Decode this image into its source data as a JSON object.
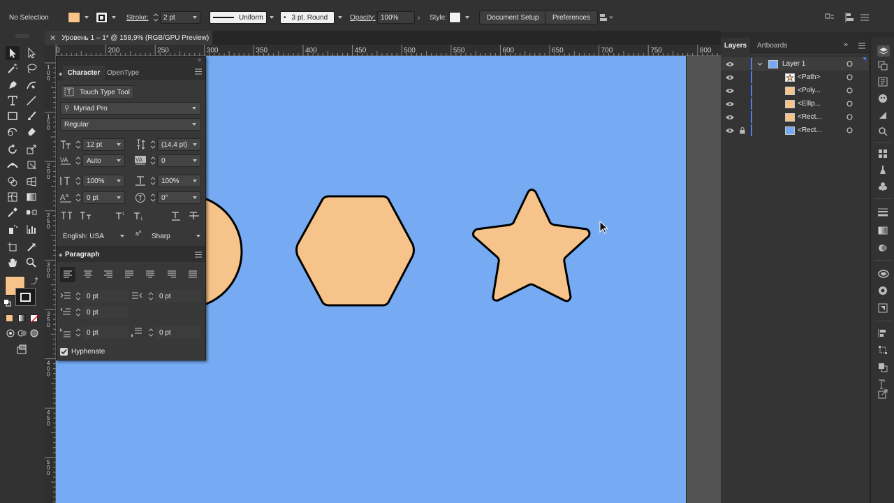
{
  "control_bar": {
    "selection_label": "No Selection",
    "fill_color": "#f6c38a",
    "stroke_label": "Stroke:",
    "stroke_weight": "2 pt",
    "profile": "Uniform",
    "brush": "3 pt. Round",
    "opacity_label": "Opacity:",
    "opacity_value": "100%",
    "style_label": "Style:",
    "document_setup": "Document Setup",
    "preferences": "Preferences"
  },
  "document_tab": {
    "title": "Уровень 1 – 1* @ 158,9% (RGB/GPU Preview)"
  },
  "ruler": {
    "h_ticks": [
      "200",
      "250",
      "300",
      "350",
      "400",
      "450",
      "500",
      "550",
      "600",
      "650",
      "700",
      "750",
      "800"
    ],
    "v_ticks": [
      "1\n0\n0",
      "1\n5\n0",
      "2\n0\n0",
      "2\n5\n0",
      "3\n0\n0",
      "3\n5\n0",
      "4\n0\n0",
      "4\n5\n0",
      "5\n0\n0"
    ]
  },
  "colors": {
    "artboard": "#76abf4",
    "shape_fill": "#f6c38a",
    "shape_stroke": "#000000",
    "panel_bg": "#383838"
  },
  "character_panel": {
    "tab_character": "Character",
    "tab_opentype": "OpenType",
    "touch_type": "Touch Type Tool",
    "font_family": "Myriad Pro",
    "font_style": "Regular",
    "font_size": "12 pt",
    "leading": "(14,4 pt)",
    "kerning": "Auto",
    "tracking": "0",
    "vertical_scale": "100%",
    "horizontal_scale": "100%",
    "baseline_shift": "0 pt",
    "rotation": "0°",
    "language": "English: USA",
    "antialias_icon": "a",
    "antialias": "Sharp"
  },
  "paragraph_panel": {
    "title": "Paragraph",
    "left_indent": "0 pt",
    "right_indent": "0 pt",
    "first_line_indent": "0 pt",
    "space_before": "0 pt",
    "space_after": "0 pt",
    "hyphenate": "Hyphenate"
  },
  "layers_panel": {
    "tab_layers": "Layers",
    "tab_artboards": "Artboards",
    "layer_name": "Layer 1",
    "items": [
      {
        "label": "<Path>",
        "thumb": "star"
      },
      {
        "label": "<Poly...",
        "thumb": "fill"
      },
      {
        "label": "<Ellip...",
        "thumb": "fill"
      },
      {
        "label": "<Rect...",
        "thumb": "fill"
      },
      {
        "label": "<Rect...",
        "thumb": "blue",
        "locked": true
      }
    ]
  }
}
